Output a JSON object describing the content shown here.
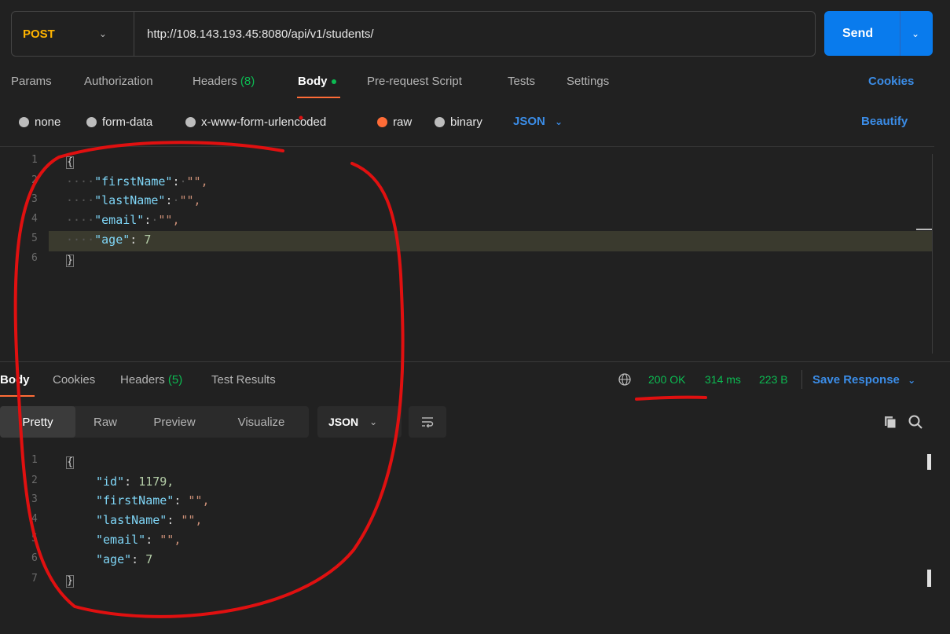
{
  "request": {
    "method": "POST",
    "url": "http://108.143.193.45:8080/api/v1/students/",
    "send_label": "Send"
  },
  "request_tabs": [
    {
      "label": "Params"
    },
    {
      "label": "Authorization"
    },
    {
      "label": "Headers",
      "count": "(8)"
    },
    {
      "label": "Body"
    },
    {
      "label": "Pre-request Script"
    },
    {
      "label": "Tests"
    },
    {
      "label": "Settings"
    }
  ],
  "cookies_label": "Cookies",
  "body_types": [
    "none",
    "form-data",
    "x-www-form-urlencoded",
    "raw",
    "binary"
  ],
  "body_format": "JSON",
  "beautify_label": "Beautify",
  "request_body": {
    "line_numbers": [
      "1",
      "2",
      "3",
      "4",
      "5",
      "6"
    ],
    "open": "{",
    "close": "}",
    "lines": [
      {
        "key": "\"firstName\"",
        "value": "\"\","
      },
      {
        "key": "\"lastName\"",
        "value": "\"\","
      },
      {
        "key": "\"email\"",
        "value": "\"\","
      },
      {
        "key": "\"age\"",
        "value": "7"
      }
    ]
  },
  "response_tabs": [
    {
      "label": "Body"
    },
    {
      "label": "Cookies"
    },
    {
      "label": "Headers",
      "count": "(5)"
    },
    {
      "label": "Test Results"
    }
  ],
  "status": {
    "code": "200 OK",
    "time": "314 ms",
    "size": "223 B"
  },
  "save_response_label": "Save Response",
  "view_tabs": [
    "Pretty",
    "Raw",
    "Preview",
    "Visualize"
  ],
  "response_format": "JSON",
  "response_body": {
    "line_numbers": [
      "1",
      "2",
      "3",
      "4",
      "5",
      "6",
      "7"
    ],
    "open": "{",
    "close": "}",
    "lines": [
      {
        "key": "\"id\"",
        "value": "1179,"
      },
      {
        "key": "\"firstName\"",
        "value": "\"\","
      },
      {
        "key": "\"lastName\"",
        "value": "\"\","
      },
      {
        "key": "\"email\"",
        "value": "\"\","
      },
      {
        "key": "\"age\"",
        "value": "7"
      }
    ]
  },
  "colors": {
    "accent": "#ff6c37",
    "link": "#3b8de8",
    "send": "#097bed",
    "method": "#ffb400",
    "success": "#0cbb52",
    "annotation": "#e01010"
  }
}
